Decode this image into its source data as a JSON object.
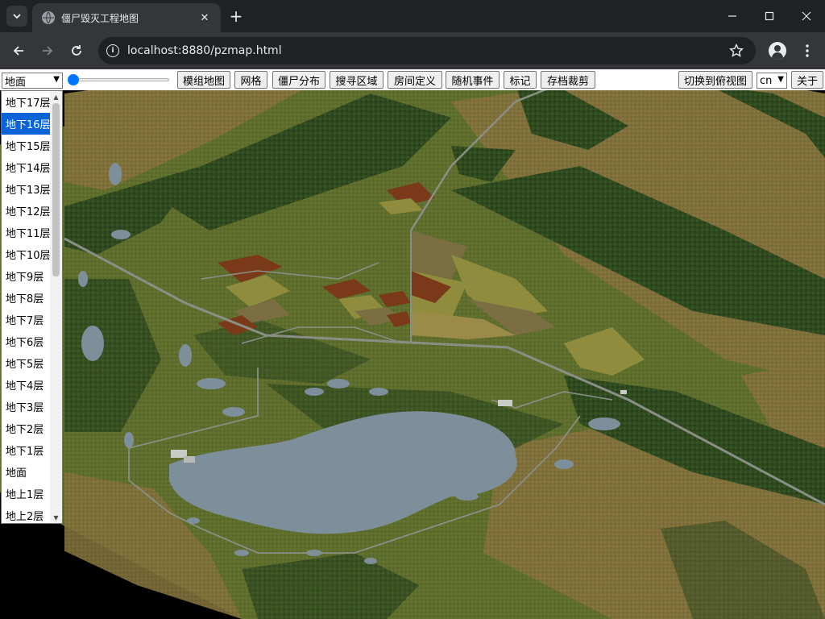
{
  "browser": {
    "tab_title": "僵尸毁灭工程地图",
    "url": "localhost:8880/pzmap.html",
    "icons": {
      "tab_search": "chevron-down-icon",
      "favicon": "globe-icon",
      "close": "close-icon",
      "new_tab": "plus-icon",
      "back": "back-arrow-icon",
      "forward": "forward-arrow-icon",
      "reload": "reload-icon",
      "info": "info-icon",
      "bookmark": "star-icon",
      "profile": "profile-icon",
      "menu": "kebab-menu-icon"
    }
  },
  "toolbar": {
    "layer_select_value": "地面",
    "slider_value": 0,
    "buttons": {
      "mod_map": "模组地图",
      "grid": "网格",
      "zombie": "僵尸分布",
      "search_area": "搜寻区域",
      "room_def": "房间定义",
      "random_event": "随机事件",
      "marker": "标记",
      "save_trim": "存档裁剪",
      "switch_view": "切换到俯视图",
      "about": "关于"
    },
    "lang_select_value": "cn"
  },
  "layers": {
    "selected": "地下16层",
    "items": [
      "地下17层",
      "地下16层",
      "地下15层",
      "地下14层",
      "地下13层",
      "地下12层",
      "地下11层",
      "地下10层",
      "地下9层",
      "地下8层",
      "地下7层",
      "地下6层",
      "地下5层",
      "地下4层",
      "地下3层",
      "地下2层",
      "地下1层",
      "地面",
      "地上1层",
      "地上2层"
    ]
  },
  "map": {
    "colors": {
      "background": "#000000",
      "forest_dark": "#2f4a1f",
      "grass": "#5f6e2c",
      "dry_field": "#85703a",
      "water": "#7d8f9b",
      "road": "#8a8f86",
      "farm_red": "#7a3a1a",
      "farm_yellow": "#8f8d3d"
    }
  }
}
